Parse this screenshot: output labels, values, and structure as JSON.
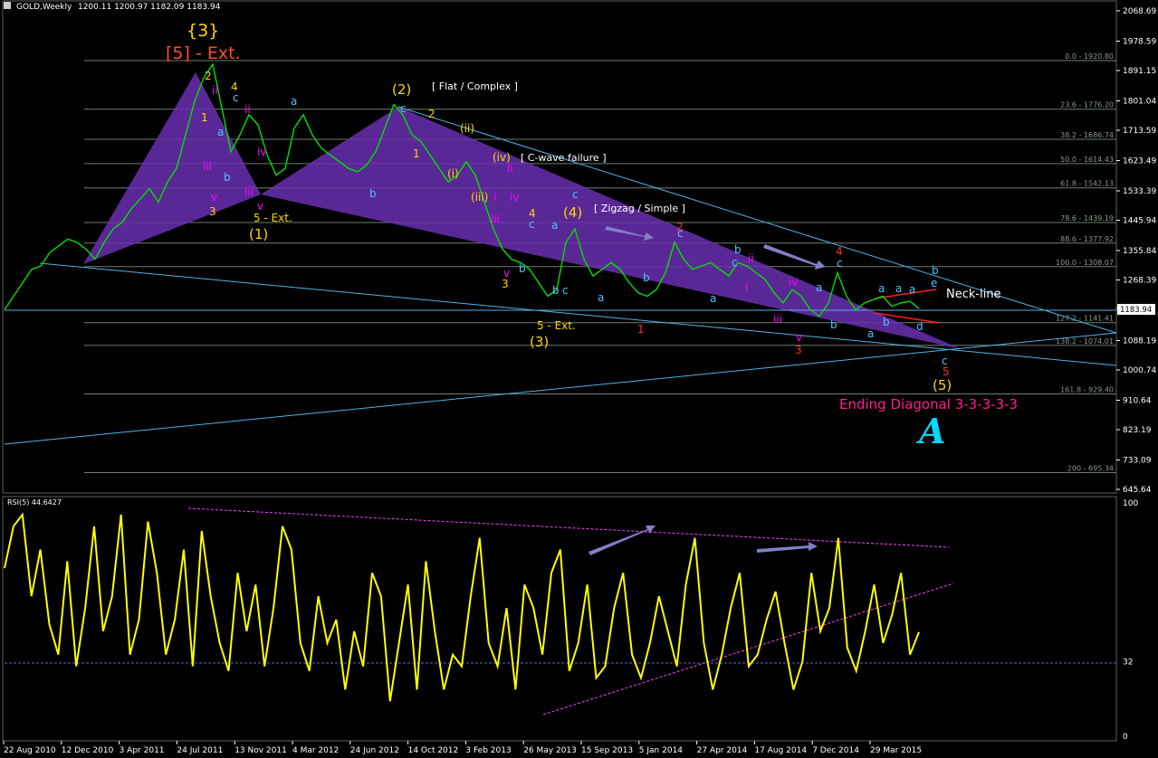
{
  "header": {
    "symbol_tf": "GOLD,Weekly",
    "ohlc": "1200.11 1200.97 1182.09 1183.94",
    "price_tag": "1183.94"
  },
  "chart_data": [
    {
      "type": "line",
      "title": "GOLD,Weekly",
      "ylim": [
        645.64,
        2068.69
      ],
      "y_ticks": [
        "2068.69",
        "1978.59",
        "1891.15",
        "1801.04",
        "1713.59",
        "1623.49",
        "1533.39",
        "1445.94",
        "1355.84",
        "1268.39",
        "1183.94",
        "1088.19",
        "1000.74",
        "910.64",
        "823.19",
        "733.09",
        "645.64"
      ],
      "x_ticks": [
        "22 Aug 2010",
        "12 Dec 2010",
        "3 Apr 2011",
        "24 Jul 2011",
        "13 Nov 2011",
        "4 Mar 2012",
        "24 Jun 2012",
        "14 Oct 2012",
        "3 Feb 2013",
        "26 May 2013",
        "15 Sep 2013",
        "5 Jan 2014",
        "27 Apr 2014",
        "17 Aug 2014",
        "7 Dec 2014",
        "29 Mar 2015"
      ],
      "series": [
        {
          "values": [
            1180,
            1220,
            1260,
            1300,
            1310,
            1350,
            1370,
            1390,
            1380,
            1360,
            1330,
            1380,
            1420,
            1440,
            1480,
            1510,
            1540,
            1500,
            1560,
            1600,
            1700,
            1800,
            1870,
            1910,
            1780,
            1650,
            1700,
            1760,
            1730,
            1640,
            1580,
            1600,
            1720,
            1760,
            1700,
            1660,
            1640,
            1620,
            1600,
            1590,
            1610,
            1650,
            1720,
            1790,
            1760,
            1700,
            1680,
            1640,
            1600,
            1560,
            1580,
            1620,
            1580,
            1500,
            1420,
            1360,
            1330,
            1320,
            1300,
            1260,
            1220,
            1240,
            1380,
            1420,
            1330,
            1280,
            1300,
            1320,
            1300,
            1260,
            1230,
            1220,
            1240,
            1290,
            1380,
            1330,
            1300,
            1310,
            1320,
            1300,
            1280,
            1320,
            1310,
            1290,
            1270,
            1230,
            1200,
            1240,
            1220,
            1180,
            1160,
            1200,
            1290,
            1220,
            1180,
            1200,
            1210,
            1220,
            1190,
            1200,
            1205,
            1183.94
          ]
        }
      ]
    },
    {
      "type": "line",
      "title": "RSI(5) 44.6427",
      "ylim": [
        0,
        100
      ],
      "y_ticks": [
        "100",
        "32",
        "0"
      ],
      "series": [
        {
          "name": "RSI(5)",
          "values": [
            72,
            90,
            95,
            60,
            80,
            48,
            35,
            75,
            30,
            55,
            90,
            45,
            60,
            95,
            35,
            50,
            92,
            70,
            35,
            50,
            80,
            30,
            88,
            60,
            40,
            28,
            70,
            45,
            65,
            30,
            55,
            90,
            80,
            40,
            28,
            60,
            40,
            50,
            20,
            45,
            30,
            70,
            60,
            15,
            40,
            65,
            20,
            75,
            45,
            20,
            35,
            30,
            60,
            85,
            40,
            30,
            55,
            20,
            65,
            55,
            35,
            70,
            80,
            28,
            40,
            65,
            25,
            30,
            55,
            70,
            35,
            25,
            40,
            60,
            45,
            30,
            65,
            85,
            40,
            20,
            35,
            55,
            70,
            30,
            35,
            50,
            62,
            40,
            20,
            32,
            70,
            45,
            55,
            85,
            38,
            28,
            45,
            65,
            40,
            52,
            70,
            35,
            44.6427
          ]
        }
      ]
    }
  ],
  "labels": {
    "wave3_curly": "{3}",
    "wave5_ext": "[5] - Ext.",
    "flat_complex": "[ Flat / Complex ]",
    "c_wave_failure": "[ C-wave failure ]",
    "zigzag_simple": "[ Zigzag / Simple ]",
    "neck_line": "Neck-line",
    "ending_diagonal": "Ending Diagonal 3-3-3-3-3",
    "five_ext_a": "5 - Ext.",
    "five_ext_b": "5 - Ext.",
    "p1": "(1)",
    "p2": "(2)",
    "p3": "(3)",
    "p4": "(4)",
    "p5": "(5)",
    "logo_letter": "A"
  },
  "fib_levels": [
    "0.0 - 1920.80",
    "23.6 - 1776.20",
    "38.2 - 1686.74",
    "50.0 - 1614.43",
    "61.8 - 1542.13",
    "78.6 - 1439.19",
    "88.6 - 1377.92",
    "100.0 - 1308.07",
    "127.2 - 1141.41",
    "138.2 - 1074.01",
    "161.8 - 929.40",
    "200 - 695.34"
  ],
  "wave_marks": [
    {
      "t": "2",
      "c": "#ffd700"
    },
    {
      "t": "ii",
      "c": "#ff00ff"
    },
    {
      "t": "4",
      "c": "#ffd700"
    },
    {
      "t": "c",
      "c": "#4fc3ff"
    },
    {
      "t": "ii",
      "c": "#ff00ff"
    },
    {
      "t": "a",
      "c": "#4fc3ff"
    },
    {
      "t": "1",
      "c": "#ffd700"
    },
    {
      "t": "a",
      "c": "#4fc3ff"
    },
    {
      "t": "iii",
      "c": "#ff00ff"
    },
    {
      "t": "b",
      "c": "#4fc3ff"
    },
    {
      "t": "v",
      "c": "#ff00ff"
    },
    {
      "t": "3",
      "c": "#ffd700"
    },
    {
      "t": "iv",
      "c": "#ff00ff"
    },
    {
      "t": "iii",
      "c": "#ff00ff"
    },
    {
      "t": "v",
      "c": "#ff00ff"
    },
    {
      "t": "b",
      "c": "#4fc3ff"
    },
    {
      "t": "1",
      "c": "#ffd700"
    },
    {
      "t": "c",
      "c": "#4fc3ff"
    },
    {
      "t": "2",
      "c": "#ffd700"
    },
    {
      "t": "(ii)",
      "c": "#ffd700"
    },
    {
      "t": "(i)",
      "c": "#ffd700"
    },
    {
      "t": "(iv)",
      "c": "#ffd700"
    },
    {
      "t": "(iii)",
      "c": "#ffd700"
    },
    {
      "t": "ii",
      "c": "#ff00ff"
    },
    {
      "t": "i",
      "c": "#ff00ff"
    },
    {
      "t": "iii",
      "c": "#ff00ff"
    },
    {
      "t": "iv",
      "c": "#ff00ff"
    },
    {
      "t": "4",
      "c": "#ffd700"
    },
    {
      "t": "c",
      "c": "#4fc3ff"
    },
    {
      "t": "a",
      "c": "#4fc3ff"
    },
    {
      "t": "v",
      "c": "#ff00ff"
    },
    {
      "t": "3",
      "c": "#ffd700"
    },
    {
      "t": "b",
      "c": "#4fc3ff"
    },
    {
      "t": "a",
      "c": "#4fc3ff"
    },
    {
      "t": "b",
      "c": "#4fc3ff"
    },
    {
      "t": "c",
      "c": "#4fc3ff"
    },
    {
      "t": "a",
      "c": "#4fc3ff"
    },
    {
      "t": "b",
      "c": "#4fc3ff"
    },
    {
      "t": "c",
      "c": "#4fc3ff"
    },
    {
      "t": "1",
      "c": "#ff3030"
    },
    {
      "t": "2",
      "c": "#ff3030"
    },
    {
      "t": "c",
      "c": "#4fc3ff"
    },
    {
      "t": "a",
      "c": "#4fc3ff"
    },
    {
      "t": "b",
      "c": "#4fc3ff"
    },
    {
      "t": "ii",
      "c": "#ff00ff"
    },
    {
      "t": "a",
      "c": "#4fc3ff"
    },
    {
      "t": "i",
      "c": "#ff00ff"
    },
    {
      "t": "iv",
      "c": "#ff00ff"
    },
    {
      "t": "iii",
      "c": "#ff00ff"
    },
    {
      "t": "v",
      "c": "#ff00ff"
    },
    {
      "t": "3",
      "c": "#ff3030"
    },
    {
      "t": "a",
      "c": "#4fc3ff"
    },
    {
      "t": "b",
      "c": "#4fc3ff"
    },
    {
      "t": "4",
      "c": "#ff3030"
    },
    {
      "t": "c",
      "c": "#4fc3ff"
    },
    {
      "t": "a",
      "c": "#4fc3ff"
    },
    {
      "t": "a",
      "c": "#4fc3ff"
    },
    {
      "t": "c",
      "c": "#4fc3ff"
    },
    {
      "t": "b",
      "c": "#4fc3ff"
    },
    {
      "t": "e",
      "c": "#4fc3ff"
    },
    {
      "t": "d",
      "c": "#4fc3ff"
    },
    {
      "t": "b",
      "c": "#4fc3ff"
    },
    {
      "t": "c",
      "c": "#4fc3ff"
    },
    {
      "t": "5",
      "c": "#ff3030"
    }
  ],
  "colors": {
    "price": "#00e000",
    "rsi": "#ffff00",
    "channel": "#4fb3e8",
    "fill": "#6a2fb0",
    "grid": "#4a5a4a",
    "fib": "#7e8e7e",
    "arrow": "#8080c8",
    "neck": "#ff2020"
  }
}
